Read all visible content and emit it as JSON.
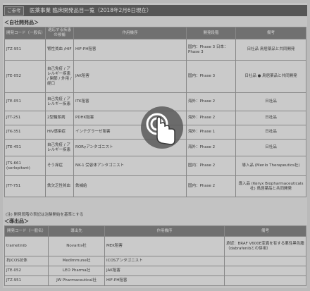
{
  "header": {
    "tag": "ご参考",
    "title": "医薬事業 臨床開発品目一覧（2018年2月6日現在）"
  },
  "own": {
    "section_title": "＜自社開発品＞",
    "columns": [
      "開発コード（一般名）",
      "適応する疾患の候補",
      "作用機序",
      "開発段階",
      "備考"
    ],
    "rows": [
      {
        "code": "JTZ-951",
        "indication": "腎性貧血 /HIF",
        "moa": "HIF-PH阻害",
        "stage": "国内：Phase 3 日本：Phase 3",
        "remark": "日社品 鳥居薬品と共同開発"
      },
      {
        "code": "JTE-052",
        "indication": "自己免疫 / アレルギー疾患 / 関節 / 外用 / 経口",
        "moa": "JAK阻害",
        "stage": "国内：Phase 3",
        "remark": "日社品 ● 鳥居薬品と共同開発"
      },
      {
        "code": "JTE-051",
        "indication": "自己免疫 / アレルギー疾患",
        "moa": "ITK阻害",
        "stage": "海外：Phase 2",
        "remark": "日社品"
      },
      {
        "code": "JTT-251",
        "indication": "2型糖尿病",
        "moa": "PDHK阻害",
        "stage": "海外：Phase 2",
        "remark": "日社品"
      },
      {
        "code": "JTK-351",
        "indication": "HIV感染症",
        "moa": "インテグラーゼ阻害",
        "stage": "海外：Phase 1",
        "remark": "日社品"
      },
      {
        "code": "JTE-451",
        "indication": "自己免疫 / アレルギー疾患",
        "moa": "RORγアンタゴニスト",
        "stage": "海外：Phase 2",
        "remark": "日社品"
      },
      {
        "code": "JTS-661 (serlopitant)",
        "indication": "そう痒症",
        "moa": "NK-1 受容体アンタゴニスト",
        "stage": "国内：Phase 2",
        "remark": "導入品 (Menlo Therapeutics社)"
      },
      {
        "code": "JTT-751",
        "indication": "鉄欠乏性貧血",
        "moa": "鉄補給",
        "stage": "国内：Phase 2",
        "remark": "導入品 (Keryx Biopharmaceuticals社) 鳥居薬品と共同開発"
      }
    ],
    "note": "(注) 開発段階の表記は治験開始を基準とする"
  },
  "licensed": {
    "section_title": "＜導出品＞",
    "columns": [
      "開発コード（一般名）",
      "導出先",
      "作用機序",
      "備考"
    ],
    "rows": [
      {
        "code": "trametinib",
        "partner": "Novartis社",
        "moa": "MEK阻害",
        "remark": "承認：BRAF V600E変異を有する悪性黒色腫（dabrafenibとの併用）"
      },
      {
        "code": "抗ICOS抗体",
        "partner": "MedImmune社",
        "moa": "ICOSアンタゴニスト",
        "remark": ""
      },
      {
        "code": "JTE-052",
        "partner": "LEO Pharma社",
        "moa": "JAK阻害",
        "remark": ""
      },
      {
        "code": "JTZ-951",
        "partner": "JW Pharmaceutical社",
        "moa": "HIF-PH阻害",
        "remark": ""
      }
    ]
  },
  "colors": {
    "header_bg": "#4f4f4f",
    "table_header": "#6e6e6e",
    "page_bg": "#d4d4d4"
  },
  "icons": {
    "touch": "tap-gesture-icon"
  }
}
